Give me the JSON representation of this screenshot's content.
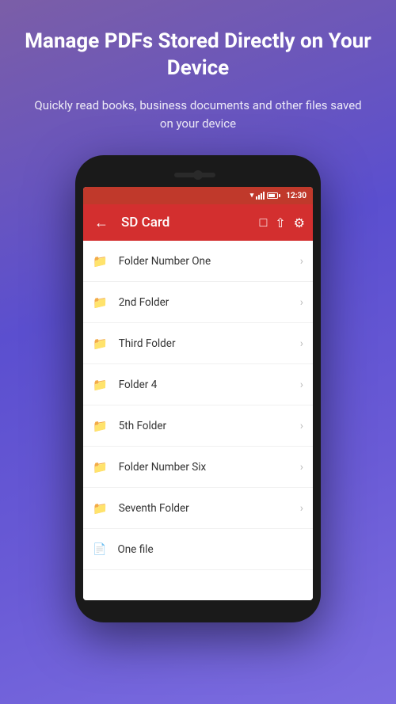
{
  "hero": {
    "title": "Manage PDFs Stored Directly on Your Device",
    "subtitle": "Quickly read books, business documents and other files saved on your device"
  },
  "statusBar": {
    "time": "12:30"
  },
  "toolbar": {
    "title": "SD Card",
    "backIcon": "←",
    "icon1": "⊡",
    "icon2": "⬆",
    "icon3": "⚙"
  },
  "fileList": [
    {
      "name": "Folder Number One",
      "type": "folder"
    },
    {
      "name": "2nd Folder",
      "type": "folder"
    },
    {
      "name": "Third Folder",
      "type": "folder"
    },
    {
      "name": "Folder 4",
      "type": "folder"
    },
    {
      "name": "5th Folder",
      "type": "folder"
    },
    {
      "name": "Folder Number Six",
      "type": "folder"
    },
    {
      "name": "Seventh Folder",
      "type": "folder"
    },
    {
      "name": "One file",
      "type": "file"
    }
  ]
}
